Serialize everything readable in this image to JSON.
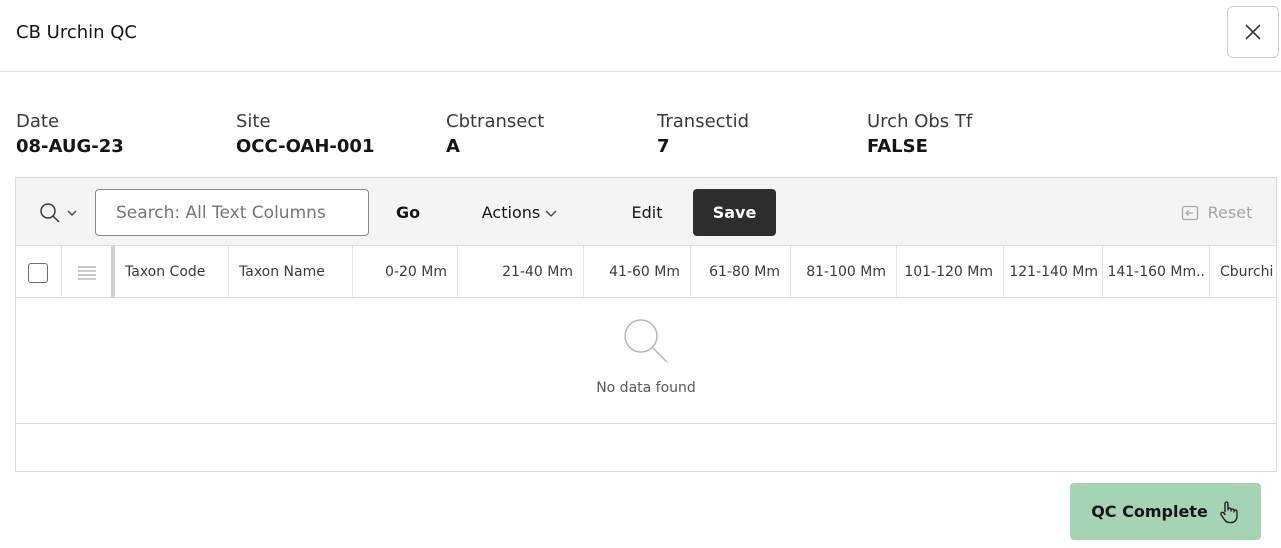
{
  "dialog": {
    "title": "CB Urchin QC"
  },
  "fields": [
    {
      "label": "Date",
      "value": "08-AUG-23"
    },
    {
      "label": "Site",
      "value": "OCC-OAH-001"
    },
    {
      "label": "Cbtransect",
      "value": "A"
    },
    {
      "label": "Transectid",
      "value": "7"
    },
    {
      "label": "Urch Obs Tf",
      "value": "FALSE"
    }
  ],
  "toolbar": {
    "search_placeholder": "Search: All Text Columns",
    "go_label": "Go",
    "actions_label": "Actions",
    "edit_label": "Edit",
    "save_label": "Save",
    "reset_label": "Reset"
  },
  "columns": [
    "Taxon Code",
    "Taxon Name",
    "0-20 Mm",
    "21-40 Mm",
    "41-60 Mm",
    "61-80 Mm",
    "81-100 Mm",
    "101-120 Mm",
    "121-140 Mm",
    "141-160 Mm..",
    "Cburchi"
  ],
  "empty_state": {
    "message": "No data found"
  },
  "footer": {
    "qc_complete_label": "QC Complete"
  },
  "colors": {
    "save_bg": "#312d2a",
    "qc_complete_bg": "#a7d3b5",
    "toolbar_bg": "#f5f4f2"
  }
}
